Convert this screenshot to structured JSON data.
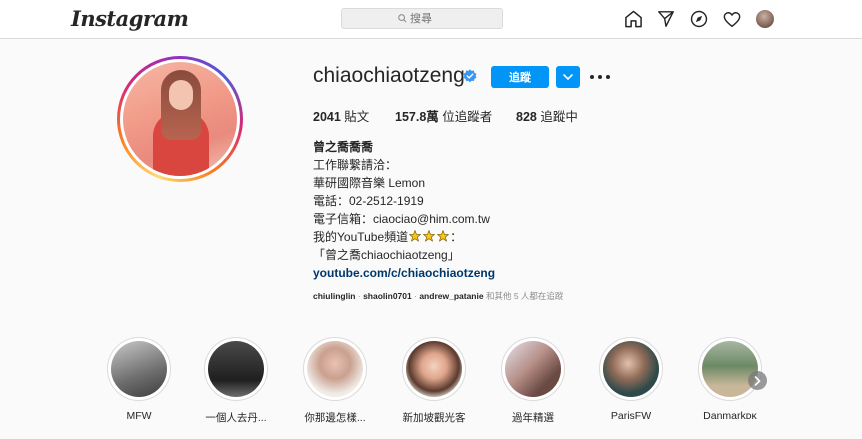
{
  "topbar": {
    "logo": "Instagram",
    "search_placeholder": "搜尋"
  },
  "profile": {
    "username": "chiaochiaotzeng",
    "follow_label": "追蹤",
    "stats": [
      {
        "value": "2041",
        "label": "貼文"
      },
      {
        "value": "157.8萬",
        "label": "位追蹤者"
      },
      {
        "value": "828",
        "label": "追蹤中"
      }
    ],
    "bio": {
      "name": "曾之喬喬喬",
      "line1": "工作聯繫請洽：",
      "line2": "華研國際音樂 Lemon",
      "line3": "電話：02-2512-1919",
      "line4": "電子信箱：ciaociao@him.com.tw",
      "line5_prefix": "我的YouTube頻道",
      "line5_suffix": "：",
      "line6": "「曾之喬chiaochiaotzeng」",
      "link": "youtube.com/c/chiaochiaotzeng"
    },
    "followed_by": {
      "user1": "chiulinglin",
      "user2": "shaolin0701",
      "user3": "andrew_patanie",
      "suffix": "和其他 5 人都在追蹤"
    }
  },
  "highlights": [
    {
      "label": "MFW"
    },
    {
      "label": "一個人去丹..."
    },
    {
      "label": "你那邊怎樣..."
    },
    {
      "label": "新加坡觀光客"
    },
    {
      "label": "過年精選"
    },
    {
      "label": "ParisFW"
    },
    {
      "label": "Danmarkᴅᴋ"
    }
  ],
  "colors": {
    "accent": "#0095f6",
    "link": "#00376b",
    "muted": "#8e8e8e"
  },
  "icons": [
    "search-icon",
    "home-icon",
    "direct-icon",
    "explore-icon",
    "heart-icon",
    "verified-badge-icon",
    "chevron-down-icon",
    "more-icon",
    "chevron-right-icon"
  ]
}
